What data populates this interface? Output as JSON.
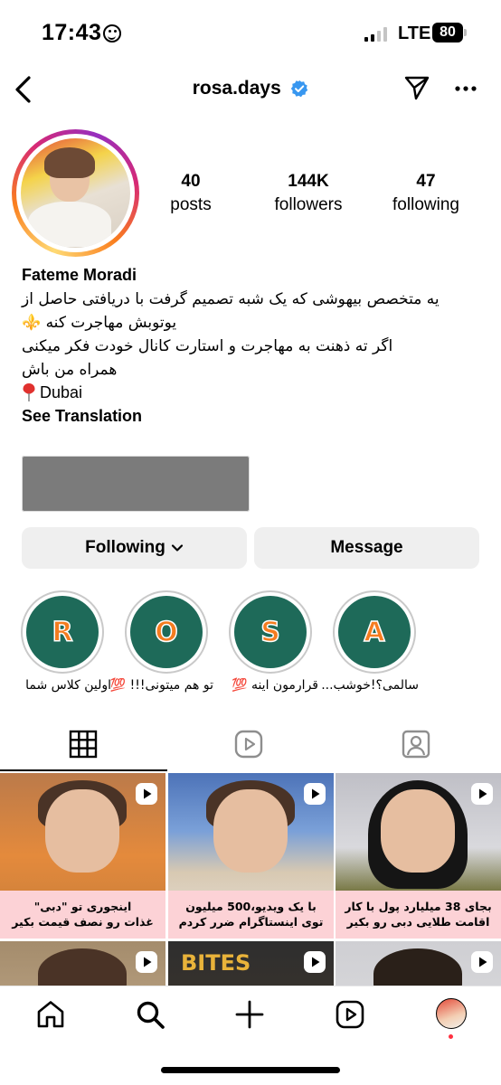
{
  "status_bar": {
    "time": "17:43",
    "network": "LTE",
    "battery": "80"
  },
  "header": {
    "username": "rosa.days"
  },
  "profile": {
    "stats": [
      {
        "value": "40",
        "label": "posts"
      },
      {
        "value": "144K",
        "label": "followers"
      },
      {
        "value": "47",
        "label": "following"
      }
    ],
    "full_name": "Fateme Moradi",
    "bio_lines": [
      "یه متخصص بیهوشی که یک شبه تصمیم گرفت با دریافتی حاصل از",
      "یوتوبش مهاجرت کنه ⚜️",
      "اگر ته ذهنت به مهاجرت و استارت کانال خودت فکر میکنی",
      "همراه من باش"
    ],
    "location": "Dubai",
    "see_translation": "See Translation"
  },
  "actions": {
    "following_label": "Following",
    "message_label": "Message"
  },
  "highlights": [
    {
      "letter": "R",
      "label": "اولین کلاس شما"
    },
    {
      "letter": "O",
      "label": "تو هم میتونی!!! 💯"
    },
    {
      "letter": "S",
      "label": "قرارمون اینه 💯"
    },
    {
      "letter": "A",
      "label": "سالمی؟!خوشب..."
    }
  ],
  "tabs": [
    "grid-icon",
    "reels-icon",
    "tagged-icon"
  ],
  "posts": [
    {
      "caption_line1": "اینجوری تو \"دبی\"",
      "caption_line2": "غذات رو نصف قیمت بکیر",
      "bg": "#d98a3a"
    },
    {
      "caption_line1": "با یک ویدیو،500 میلیون",
      "caption_line2": "توی اینستاگرام ضرر کردم",
      "bg": "#5a7fc4"
    },
    {
      "caption_line1": "بجای 38 میلیارد پول با کار",
      "caption_line2": "اقامت طلایی دبی رو بکیر",
      "bg": "#c9c9cf"
    },
    {
      "bg": "#c8b59a"
    },
    {
      "bg": "#3a3a3a",
      "overlay_text": "BITES"
    },
    {
      "bg": "#d5d5d8"
    }
  ],
  "nav": [
    "home-icon",
    "search-icon",
    "create-icon",
    "reels-icon",
    "profile-avatar"
  ],
  "colors": {
    "highlight_bg": "#1e6a59",
    "highlight_letter": "#f57c1f",
    "verified": "#3897f0",
    "caption_bg": "#fcd2d6"
  }
}
